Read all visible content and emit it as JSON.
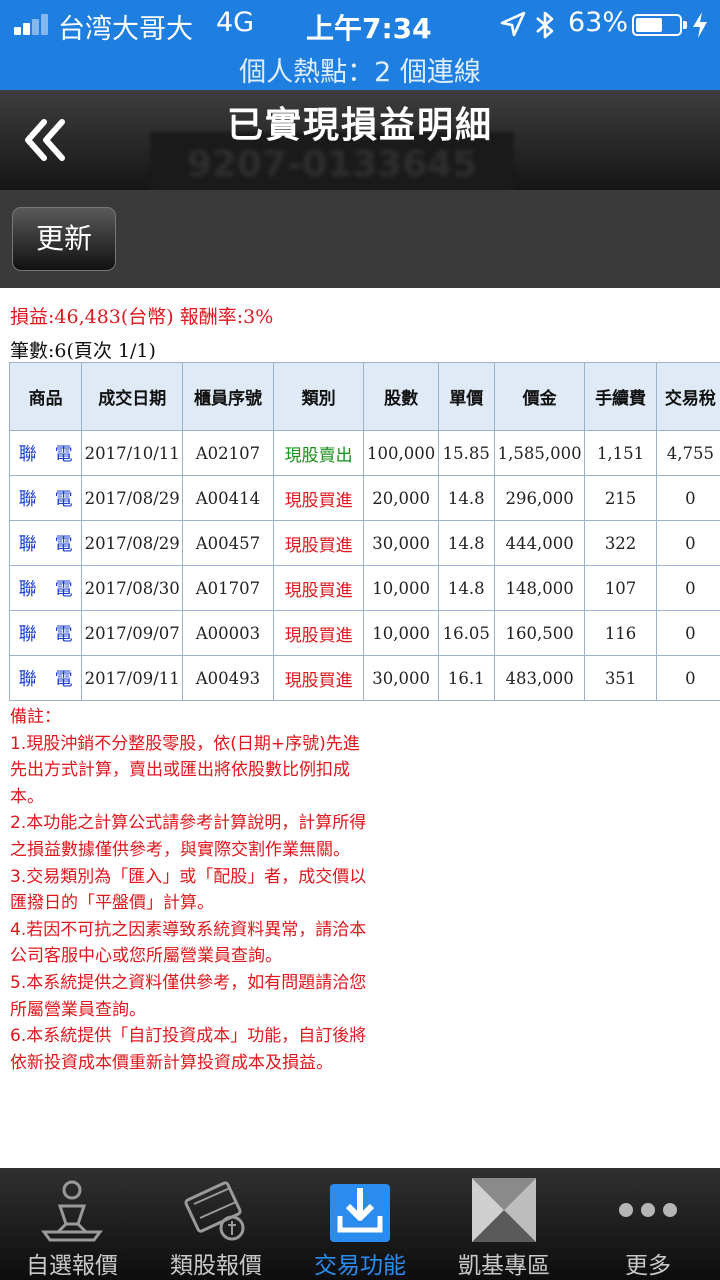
{
  "status_bar": {
    "carrier": "台湾大哥大",
    "network": "4G",
    "time": "上午7:34",
    "battery_percent": "63%",
    "battery_level": 0.63,
    "hotspot": "個人熱點：2 個連線"
  },
  "header": {
    "title": "已實現損益明細",
    "account": "9207-0133645"
  },
  "toolbar": {
    "refresh_label": "更新"
  },
  "summary": {
    "pnl_text": "損益:46,483(台幣) 報酬率:3%",
    "count_text": "筆數:6(頁次 1/1)"
  },
  "table": {
    "columns": [
      "商品",
      "成交日期",
      "櫃員序號",
      "類別",
      "股數",
      "單價",
      "價金",
      "手續費",
      "交易稅"
    ],
    "rows": [
      [
        "聯　電",
        "2017/10/11",
        "A02107",
        "現股賣出",
        "100,000",
        "15.85",
        "1,585,000",
        "1,151",
        "4,755"
      ],
      [
        "聯　電",
        "2017/08/29",
        "A00414",
        "現股買進",
        "20,000",
        "14.8",
        "296,000",
        "215",
        "0"
      ],
      [
        "聯　電",
        "2017/08/29",
        "A00457",
        "現股買進",
        "30,000",
        "14.8",
        "444,000",
        "322",
        "0"
      ],
      [
        "聯　電",
        "2017/08/30",
        "A01707",
        "現股買進",
        "10,000",
        "14.8",
        "148,000",
        "107",
        "0"
      ],
      [
        "聯　電",
        "2017/09/07",
        "A00003",
        "現股買進",
        "10,000",
        "16.05",
        "160,500",
        "116",
        "0"
      ],
      [
        "聯　電",
        "2017/09/11",
        "A00493",
        "現股買進",
        "30,000",
        "16.1",
        "483,000",
        "351",
        "0"
      ]
    ]
  },
  "notes": [
    "備註：",
    "1.現股沖銷不分整股零股，依(日期+序號)先進先出方式計算，賣出或匯出將依股數比例扣成本。",
    "2.本功能之計算公式請參考計算說明，計算所得之損益數據僅供參考，與實際交割作業無關。",
    "3.交易類別為「匯入」或「配股」者，成交價以匯撥日的「平盤價」計算。",
    "4.若因不可抗之因素導致系統資料異常，請洽本公司客服中心或您所屬營業員查詢。",
    "5.本系統提供之資料僅供參考，如有問題請洽您所屬營業員查詢。",
    "6.本系統提供「自訂投資成本」功能，自訂後將依新投資成本價重新計算投資成本及損益。"
  ],
  "tabs": [
    {
      "label": "自選報價",
      "icon": "watchlist-icon"
    },
    {
      "label": "類股報價",
      "icon": "sector-quote-icon"
    },
    {
      "label": "交易功能",
      "icon": "trade-icon",
      "active": true
    },
    {
      "label": "凱基專區",
      "icon": "kgi-zone-icon"
    },
    {
      "label": "更多",
      "icon": "more-icon"
    }
  ],
  "colors": {
    "status_bar": "#1f7fe0",
    "accent_red": "#e0171d",
    "sell_green": "#1a8f1a",
    "stock_blue": "#1a3fd0",
    "active_tab": "#2b8cf0"
  }
}
